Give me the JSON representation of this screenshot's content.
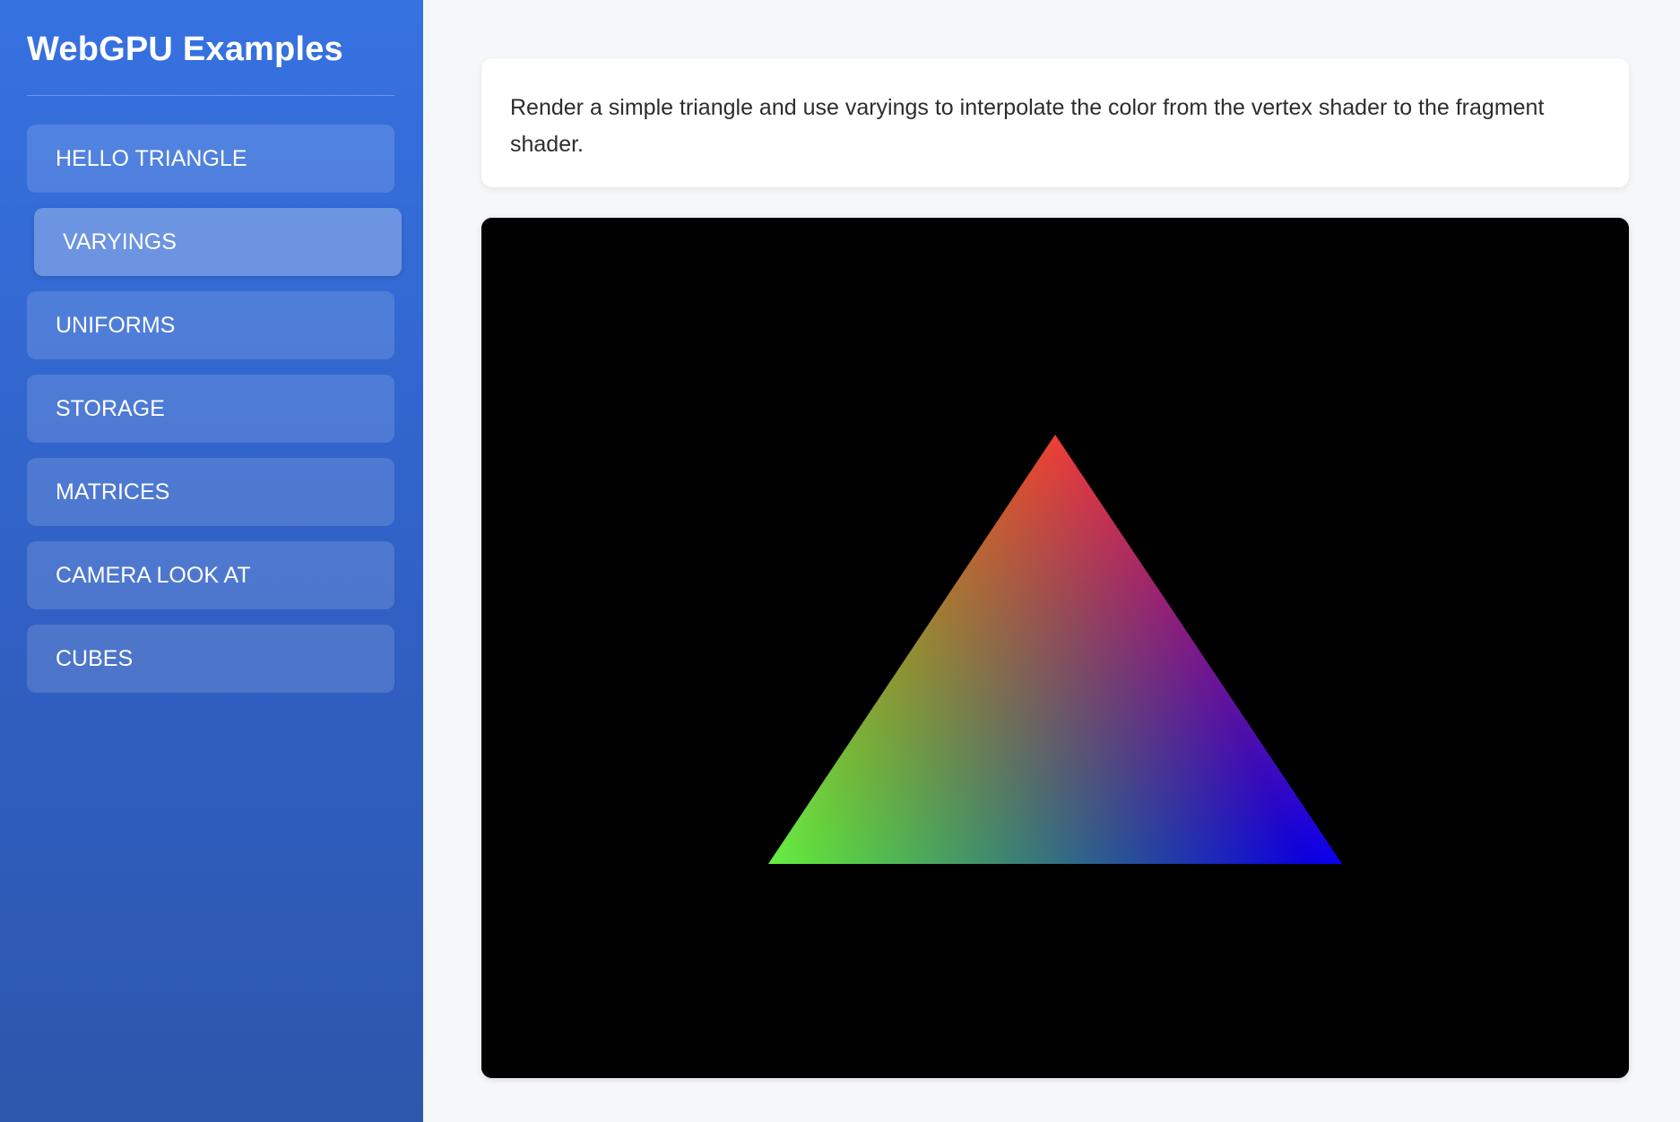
{
  "sidebar": {
    "title": "WebGPU Examples",
    "items": [
      {
        "label": "HELLO TRIANGLE",
        "active": false
      },
      {
        "label": "VARYINGS",
        "active": true
      },
      {
        "label": "UNIFORMS",
        "active": false
      },
      {
        "label": "STORAGE",
        "active": false
      },
      {
        "label": "MATRICES",
        "active": false
      },
      {
        "label": "CAMERA LOOK AT",
        "active": false
      },
      {
        "label": "CUBES",
        "active": false
      }
    ]
  },
  "main": {
    "description": "Render a simple triangle and use varyings to interpolate the color from the vertex shader to the fragment shader."
  },
  "render": {
    "background_color": "#000000",
    "vertex_colors": {
      "top": "#ee3124",
      "bottom_left": "#66ef44",
      "bottom_right": "#0a00f0"
    }
  }
}
